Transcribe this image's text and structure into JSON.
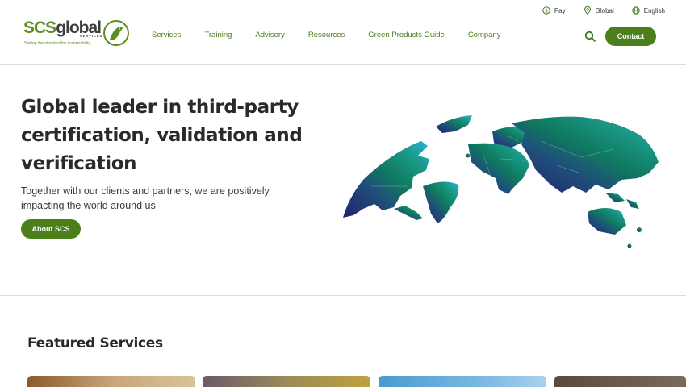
{
  "utility_nav": [
    {
      "label": "Pay",
      "icon": "dollar-circle-icon"
    },
    {
      "label": "Global",
      "icon": "location-pin-icon"
    },
    {
      "label": "English",
      "icon": "globe-icon"
    }
  ],
  "logo": {
    "brand_scs": "SCS",
    "brand_global": "global",
    "brand_services": "SERVICES",
    "tagline": "Setting the standard for sustainability",
    "icon": "bird-logo-icon"
  },
  "main_nav": [
    "Services",
    "Training",
    "Advisory",
    "Resources",
    "Green Products Guide",
    "Company"
  ],
  "header": {
    "search_icon": "search-icon",
    "contact_label": "Contact"
  },
  "hero": {
    "title": "Global leader in third-party certification, validation and verification",
    "subtitle": "Together with our clients and partners, we are positively impacting the world around us",
    "button_label": "About SCS",
    "image": "world-map-illustration"
  },
  "featured": {
    "title": "Featured Services",
    "cards": [
      "featured-card-food",
      "featured-card-flowers",
      "featured-card-sky",
      "featured-card-dark"
    ]
  },
  "colors": {
    "brand_green": "#4a7f1c",
    "nav_green": "#4d7d1c",
    "text_dark": "#2a2a2a"
  }
}
